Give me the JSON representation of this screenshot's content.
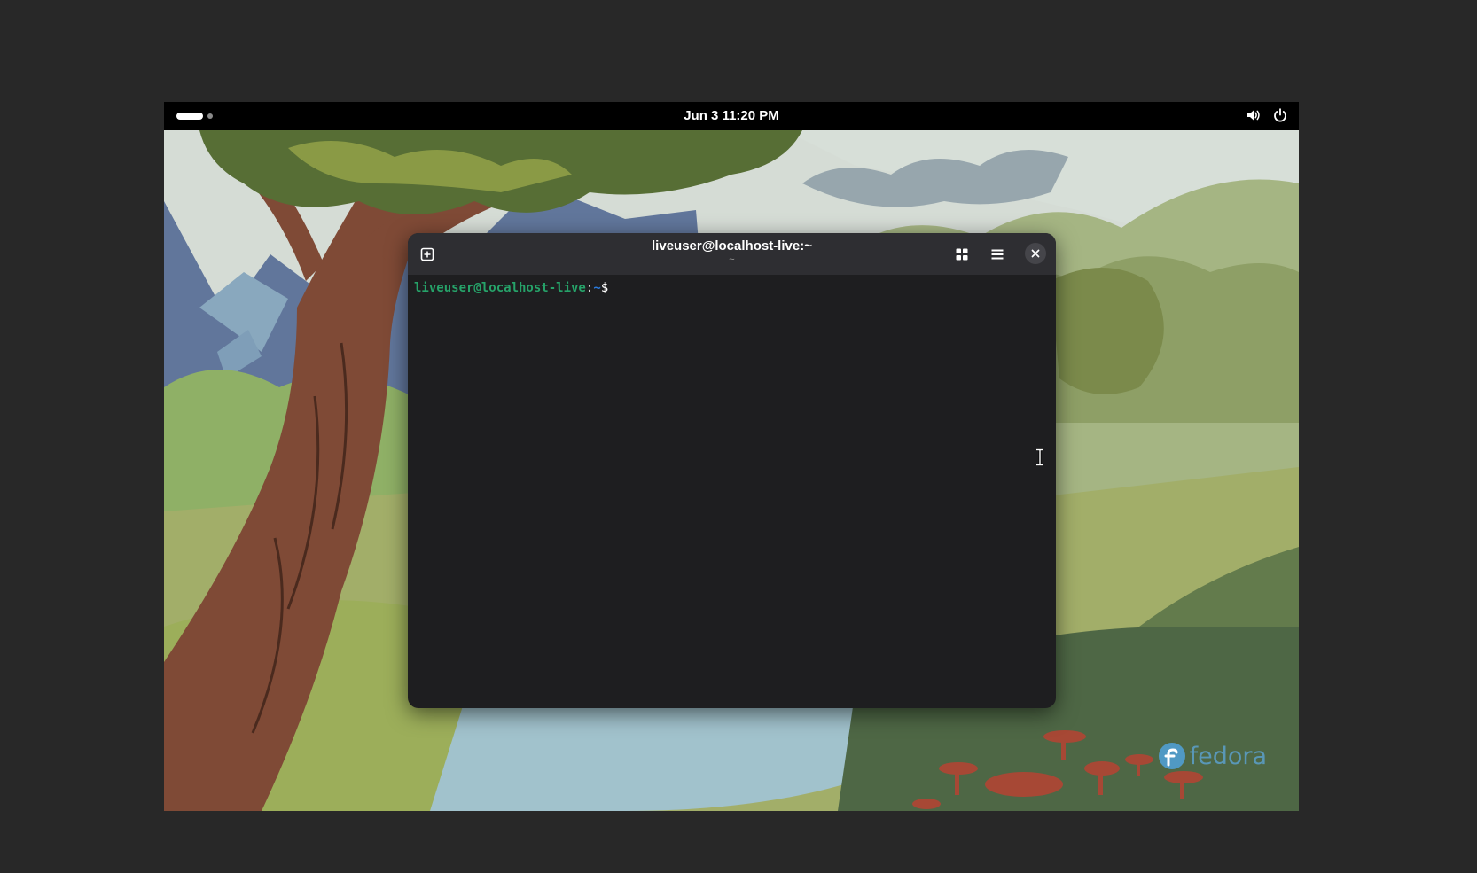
{
  "topbar": {
    "clock": "Jun 3  11:20 PM",
    "icons": [
      "workspace-indicator",
      "volume-icon",
      "power-icon"
    ]
  },
  "terminal": {
    "title": "liveuser@localhost-live:~",
    "subtitle": "~",
    "header_icons": [
      "new-tab-icon",
      "tab-overview-icon",
      "menu-icon",
      "close-icon"
    ],
    "prompt": {
      "user_host": "liveuser@localhost-live",
      "separator": ":",
      "path": "~",
      "symbol": "$"
    }
  },
  "wallpaper": {
    "brand_text": "fedora",
    "brand_color": "#51a2da"
  },
  "colors": {
    "terminal_bg": "#1e1e20",
    "header_bg": "#2e2e32",
    "prompt_green": "#26a269",
    "prompt_blue": "#2a7bde"
  }
}
